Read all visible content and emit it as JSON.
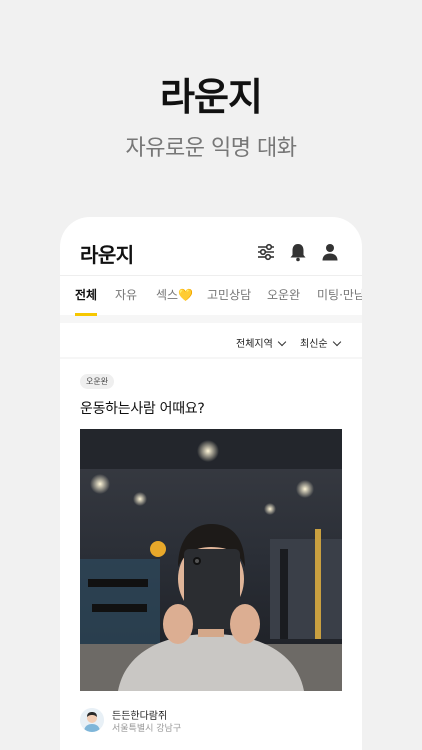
{
  "hero": {
    "title": "라운지",
    "subtitle": "자유로운 익명 대화"
  },
  "header": {
    "title": "라운지",
    "icons": [
      "filter-sliders-icon",
      "bell-icon",
      "user-profile-icon"
    ]
  },
  "tabs": [
    {
      "label": "전체",
      "active": true
    },
    {
      "label": "자유",
      "active": false
    },
    {
      "label": "섹스💛",
      "active": false
    },
    {
      "label": "고민상담",
      "active": false
    },
    {
      "label": "오운완",
      "active": false
    },
    {
      "label": "미팅·만남",
      "active": false
    }
  ],
  "filters": {
    "region_label": "전체지역",
    "sort_label": "최신순"
  },
  "post": {
    "badge": "오운완",
    "title": "운동하는사람 어때요?",
    "author": "든든한다람쥐",
    "location": "서울특별시 강남구"
  },
  "colors": {
    "accent": "#f6c700",
    "background": "#f1f1f1"
  }
}
